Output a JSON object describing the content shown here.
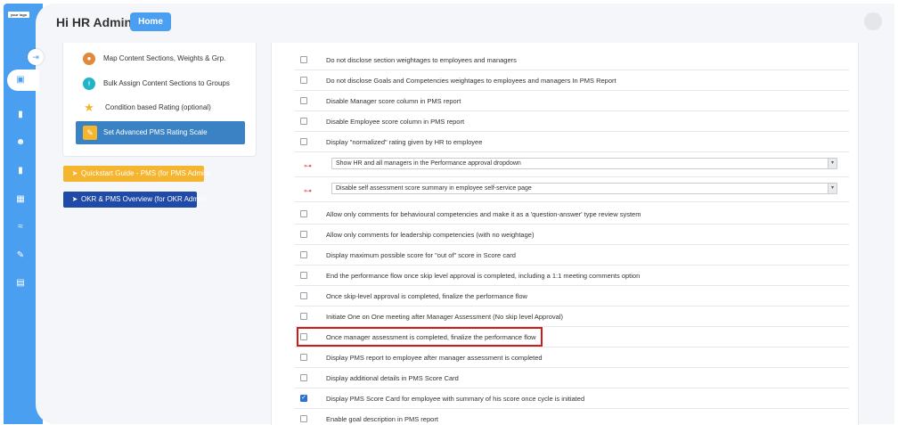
{
  "sidebar": {
    "logo_text": "your logo",
    "toggle_icon": "collapse-arrow-icon",
    "icons": [
      "dashboard-icon",
      "book-icon",
      "users-icon",
      "book-icon",
      "calendar-icon",
      "handshake-icon",
      "edit-document-icon",
      "report-icon"
    ],
    "accent_color": "#4a9ff0"
  },
  "header": {
    "greeting": "Hi HR Admin",
    "home_label": "Home"
  },
  "left_menu": {
    "items": [
      {
        "label": "Map Content Sections, Weights & Grp.",
        "icon": "user-map-icon"
      },
      {
        "label": "Bulk Assign Content Sections to Groups",
        "icon": "bulk-assign-icon"
      },
      {
        "label": "Condition based Rating (optional)",
        "icon": "star-icon"
      }
    ],
    "active_item": {
      "label": "Set Advanced PMS Rating Scale",
      "icon": "rating-scale-icon"
    }
  },
  "guides": {
    "quickstart_label": "Quickstart Guide - PMS (for PMS Admin)",
    "okr_label": "OKR & PMS Overview (for OKR Admin)"
  },
  "settings": {
    "rows": [
      {
        "type": "checkbox",
        "label": "Do not disclose section weightages to employees and managers",
        "checked": false
      },
      {
        "type": "checkbox",
        "label": "Do not disclose Goals and Competencies weightages to employees and managers In PMS Report",
        "checked": false
      },
      {
        "type": "checkbox",
        "label": "Disable Manager score column in PMS report",
        "checked": false
      },
      {
        "type": "checkbox",
        "label": "Disable Employee score column in PMS report",
        "checked": false
      },
      {
        "type": "checkbox",
        "label": "Display \"normalized\" rating given by HR to employee",
        "checked": false
      },
      {
        "type": "select",
        "label": "Show HR and all managers in the Performance approval dropdown"
      },
      {
        "type": "select",
        "label": "Disable self assessment score summary in employee self-service page"
      },
      {
        "type": "checkbox",
        "label": "Allow only comments for behavioural competencies and make it as a 'question-answer' type review system",
        "checked": false
      },
      {
        "type": "checkbox",
        "label": "Allow only comments for leadership competencies (with no weightage)",
        "checked": false
      },
      {
        "type": "checkbox",
        "label": "Display maximum possible score for \"out of\" score in Score card",
        "checked": false
      },
      {
        "type": "checkbox",
        "label": "End the performance flow once skip level approval is completed, including a 1:1 meeting comments option",
        "checked": false
      },
      {
        "type": "checkbox",
        "label": "Once skip-level approval is completed, finalize the performance flow",
        "checked": false
      },
      {
        "type": "checkbox",
        "label": "Initiate One on One meeting after Manager Assessment (No skip level Approval)",
        "checked": false
      },
      {
        "type": "checkbox",
        "label": "Once manager assessment is completed, finalize the performance flow",
        "checked": false
      },
      {
        "type": "checkbox",
        "label": "Display PMS report to employee after manager assessment is completed",
        "checked": false
      },
      {
        "type": "checkbox",
        "label": "Display additional details in PMS Score Card",
        "checked": false
      },
      {
        "type": "checkbox",
        "label": "Display PMS Score Card for employee with summary of his score once cycle is initiated",
        "checked": true
      },
      {
        "type": "checkbox",
        "label": "Enable goal description in PMS report",
        "checked": false
      }
    ]
  }
}
